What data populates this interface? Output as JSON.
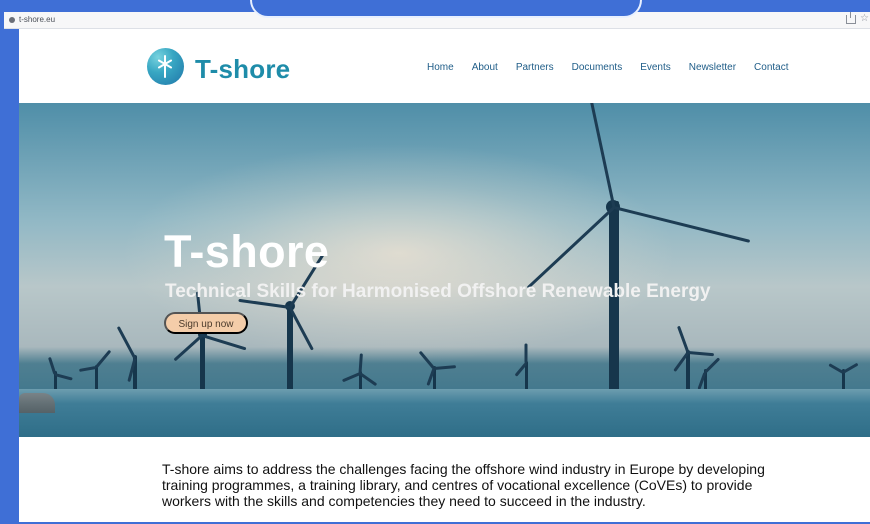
{
  "browser": {
    "url": "t-shore.eu"
  },
  "header": {
    "logo_text": "T-shore",
    "nav": [
      "Home",
      "About",
      "Partners",
      "Documents",
      "Events",
      "Newsletter",
      "Contact"
    ]
  },
  "hero": {
    "title": "T-shore",
    "subtitle": "Technical Skills for Harmonised Offshore Renewable Energy",
    "button_label": "Sign up now"
  },
  "intro": {
    "text": "T-shore aims to address the challenges facing the offshore wind industry in Europe by developing training programmes, a training library, and centres of vocational excellence (CoVEs) to provide workers with the skills and competencies they need to succeed in the industry."
  },
  "icons": {
    "logo_icon": "wind-turbine-icon",
    "share_icon": "share-icon",
    "bookmark_icon": "star-icon"
  },
  "colors": {
    "accent": "#1e8ca9",
    "button": "#f4cda9",
    "frame": "#3f6fd6"
  }
}
